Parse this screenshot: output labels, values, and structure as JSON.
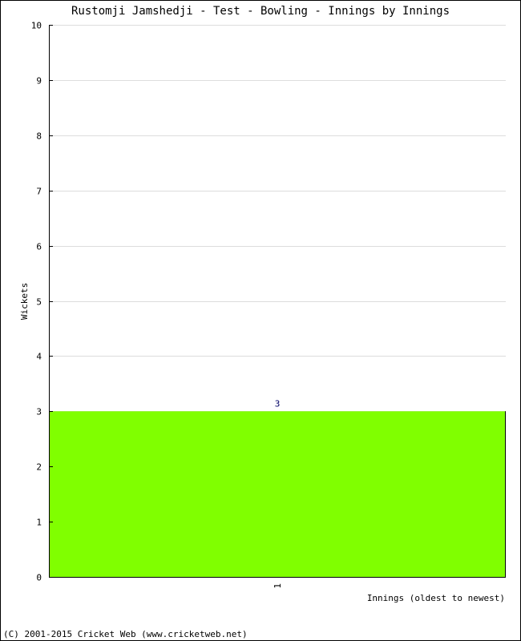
{
  "chart_data": {
    "type": "bar",
    "title": "Rustomji Jamshedji - Test - Bowling - Innings by Innings",
    "xlabel": "Innings (oldest to newest)",
    "ylabel": "Wickets",
    "categories": [
      "1"
    ],
    "values": [
      3
    ],
    "data_labels": [
      "3"
    ],
    "ylim": [
      0,
      10
    ],
    "yticks": [
      "0",
      "1",
      "2",
      "3",
      "4",
      "5",
      "6",
      "7",
      "8",
      "9",
      "10"
    ],
    "grid": true,
    "legend": "none",
    "colors": {
      "bar": "#80ff00",
      "grid": "#dddddd",
      "axis": "#000000",
      "data_label": "#000066"
    }
  },
  "footer": {
    "copyright": "(C) 2001-2015 Cricket Web (www.cricketweb.net)"
  }
}
